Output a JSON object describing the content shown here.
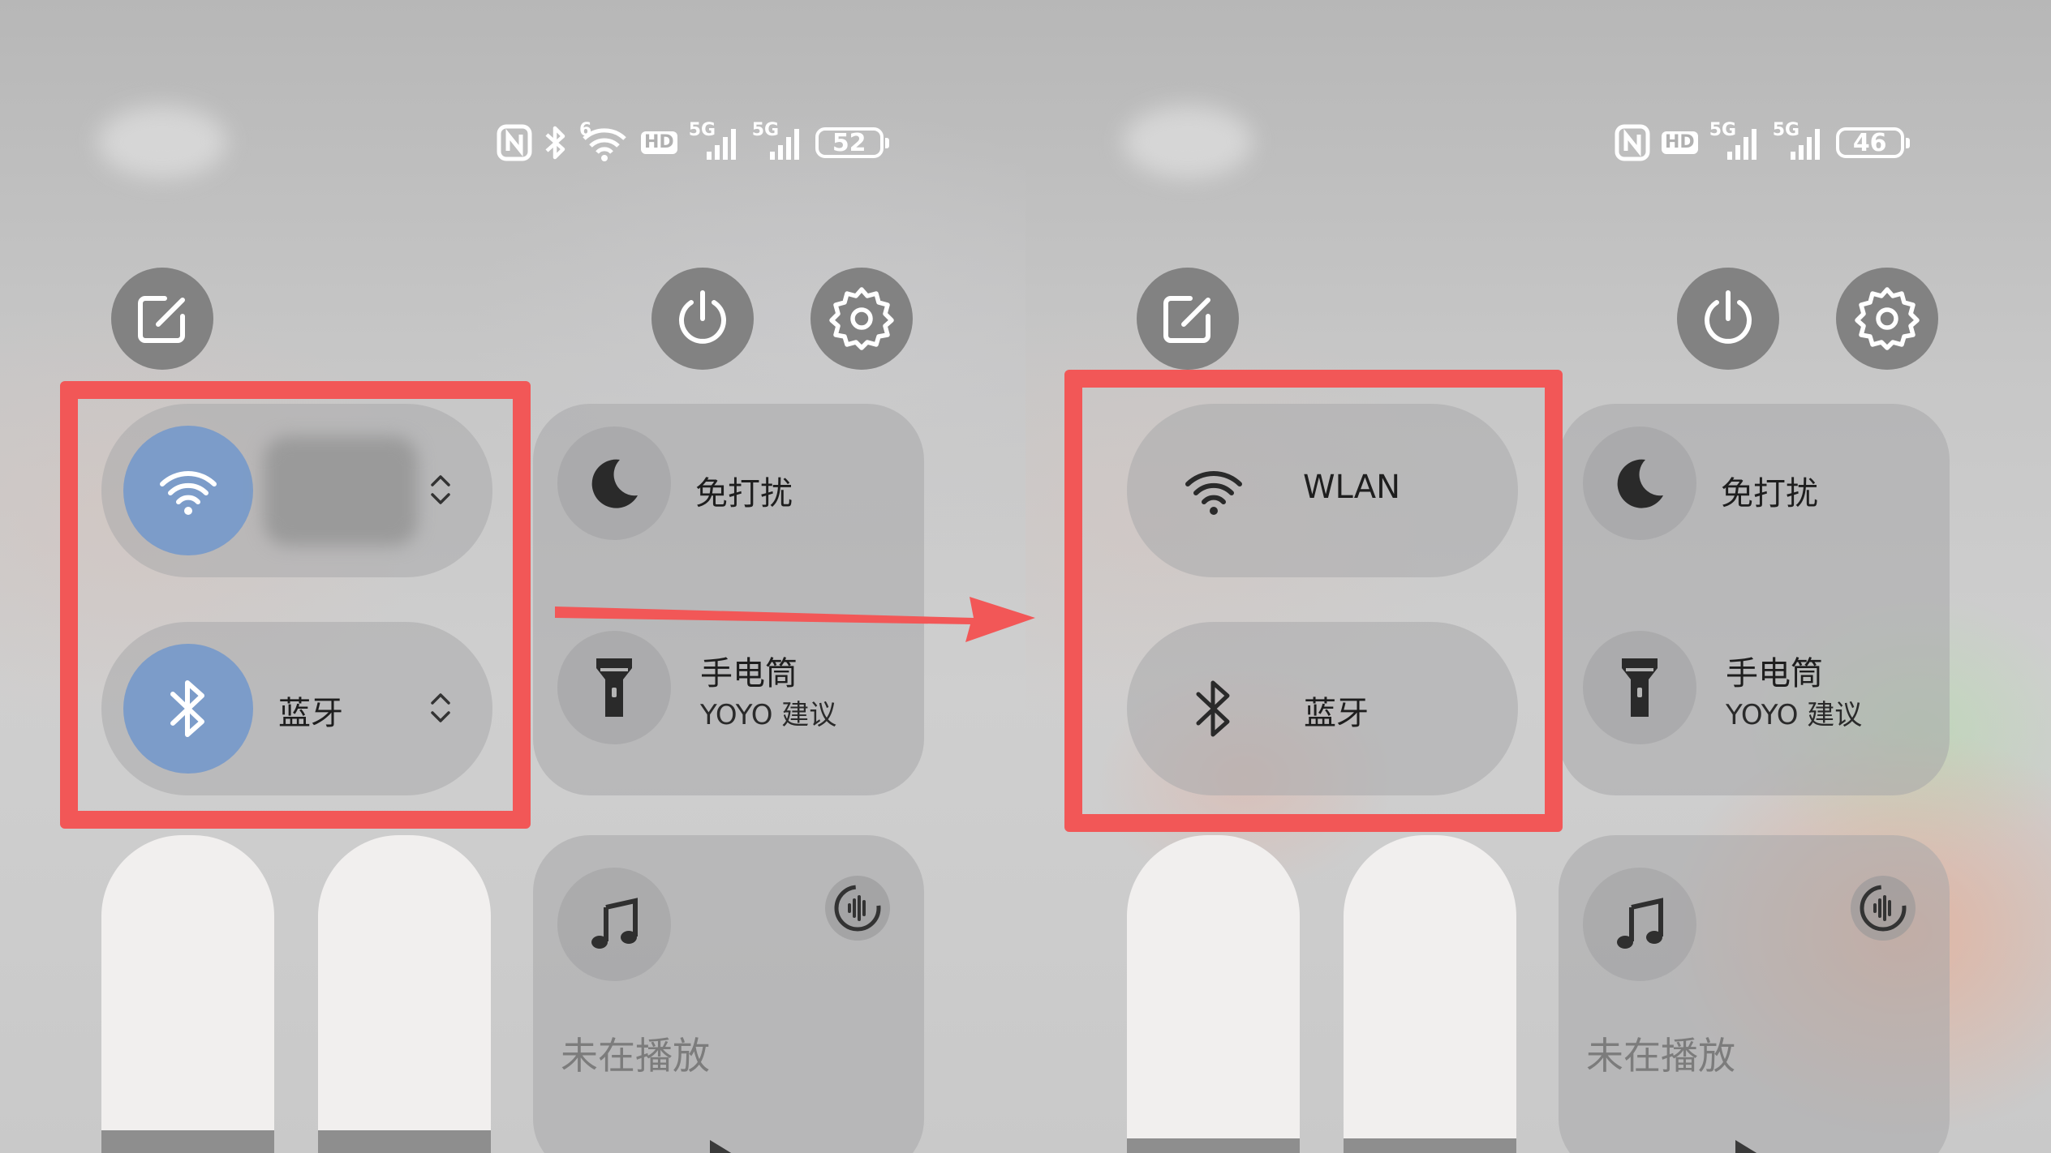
{
  "left_panel": {
    "status_bar": {
      "nfc_icon": "nfc-icon",
      "bluetooth_icon": "bluetooth-icon",
      "wifi_icon": "wifi-6-icon",
      "wifi_label": "6",
      "hd_label": "HD",
      "sim1_label": "5G",
      "sim2_label": "5G",
      "battery_level": "52"
    },
    "quick_buttons": {
      "edit_icon": "edit-icon",
      "power_icon": "power-icon",
      "settings_icon": "gear-icon"
    },
    "connectivity": {
      "wifi": {
        "label": "",
        "active": true,
        "icon": "wifi-icon"
      },
      "bluetooth": {
        "label": "蓝牙",
        "active": true,
        "icon": "bluetooth-icon"
      }
    },
    "tiles": {
      "dnd": {
        "label": "免打扰",
        "icon": "moon-icon"
      },
      "flashlight": {
        "label": "手电筒",
        "sub": "YOYO 建议",
        "icon": "flashlight-icon"
      }
    },
    "media": {
      "title": "未在播放",
      "icon": "music-note-icon",
      "audio_icon": "audio-output-icon"
    }
  },
  "right_panel": {
    "status_bar": {
      "nfc_icon": "nfc-icon",
      "hd_label": "HD",
      "sim1_label": "5G",
      "sim2_label": "5G",
      "battery_level": "46"
    },
    "quick_buttons": {
      "edit_icon": "edit-icon",
      "power_icon": "power-icon",
      "settings_icon": "gear-icon"
    },
    "connectivity": {
      "wifi": {
        "label": "WLAN",
        "active": false,
        "icon": "wifi-icon"
      },
      "bluetooth": {
        "label": "蓝牙",
        "active": false,
        "icon": "bluetooth-icon"
      }
    },
    "tiles": {
      "dnd": {
        "label": "免打扰",
        "icon": "moon-icon"
      },
      "flashlight": {
        "label": "手电筒",
        "sub": "YOYO 建议",
        "icon": "flashlight-icon"
      }
    },
    "media": {
      "title": "未在播放",
      "icon": "music-note-icon",
      "audio_icon": "audio-output-icon"
    }
  },
  "annotations": {
    "highlight_color": "#f25757",
    "arrow_icon": "arrow-right-icon"
  }
}
